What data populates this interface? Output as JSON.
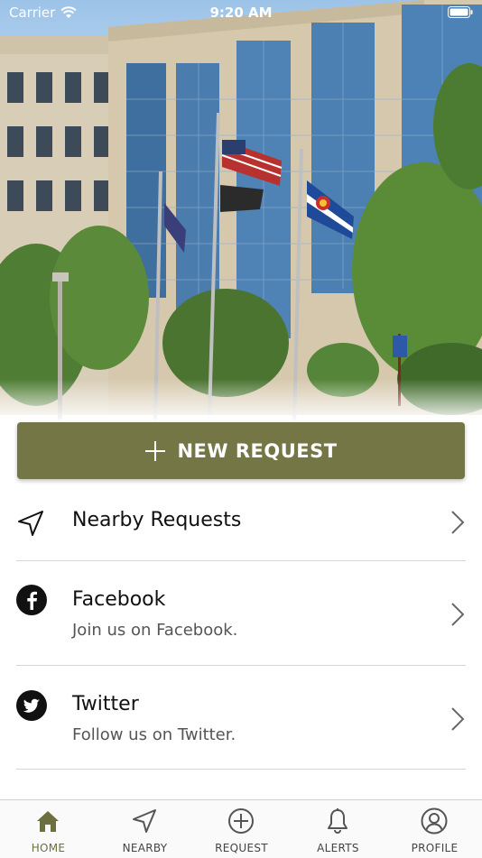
{
  "status_bar": {
    "carrier": "Carrier",
    "time": "9:20 AM"
  },
  "hero": {
    "image": "municipal building with flags"
  },
  "new_request": {
    "label": "NEW REQUEST",
    "color": "#757646"
  },
  "menu": {
    "items": [
      {
        "title": "Nearby Requests",
        "subtitle": "",
        "icon": "navigation-arrow-icon"
      },
      {
        "title": "Facebook",
        "subtitle": "Join us on Facebook.",
        "icon": "facebook-icon"
      },
      {
        "title": "Twitter",
        "subtitle": "Follow us on Twitter.",
        "icon": "twitter-icon"
      }
    ]
  },
  "tabbar": {
    "active_color": "#6e6f3e",
    "tabs": [
      {
        "label": "HOME",
        "icon": "home-icon",
        "active": true
      },
      {
        "label": "NEARBY",
        "icon": "navigation-arrow-icon",
        "active": false
      },
      {
        "label": "REQUEST",
        "icon": "plus-circle-icon",
        "active": false
      },
      {
        "label": "ALERTS",
        "icon": "bell-icon",
        "active": false
      },
      {
        "label": "PROFILE",
        "icon": "user-icon",
        "active": false
      }
    ]
  }
}
